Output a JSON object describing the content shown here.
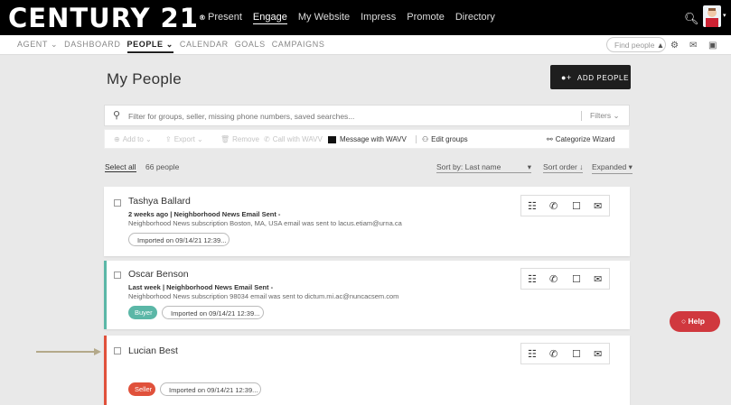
{
  "brand": {
    "logo_text": "CENTURY 21",
    "logo_mark": "®"
  },
  "topnav": [
    "Present",
    "Engage",
    "My Website",
    "Impress",
    "Promote",
    "Directory"
  ],
  "subnav": [
    "AGENT ⌄",
    "DASHBOARD",
    "PEOPLE ⌄",
    "CALENDAR",
    "GOALS",
    "CAMPAIGNS"
  ],
  "find_people_placeholder": "Find people",
  "page": {
    "title": "My People",
    "add_people_label": "ADD PEOPLE",
    "search_placeholder": "Filter for groups, seller, missing phone numbers, saved searches...",
    "filters_label": "Filters ⌄"
  },
  "actions": {
    "add_to": "Add to ⌄",
    "export": "Export ⌄",
    "remove": "Remove",
    "call_wav": "Call with WAVV",
    "message_wav": "Message with WAVV",
    "edit_groups": "Edit groups",
    "categorize_wizard": "Categorize Wizard"
  },
  "list_controls": {
    "select_all": "Select all",
    "count": "66 people",
    "sort_by_label": "Sort by: Last name",
    "sort_caret": "▾",
    "sort_order": "Sort order ↓",
    "view": "Expanded ▾"
  },
  "people": [
    {
      "name": "Tashya Ballard",
      "when": "2 weeks ago",
      "event": "Neighborhood News Email Sent -",
      "detail": "Neighborhood News subscription Boston, MA, USA email was sent to lacus.etiam@urna.ca",
      "imported": "Imported on 09/14/21 12:39..."
    },
    {
      "name": "Oscar Benson",
      "when": "Last week",
      "event": "Neighborhood News Email Sent -",
      "detail": "Neighborhood News subscription 98034 email was sent to dictum.mi.ac@nuncacsem.com",
      "tag": "Buyer",
      "imported": "Imported on 09/14/21 12:39..."
    },
    {
      "name": "Lucian Best",
      "tag": "Seller",
      "imported": "Imported on 09/14/21 12:39..."
    }
  ],
  "help_label": "Help",
  "colors": {
    "buyer": "#5bb7a7",
    "seller": "#e0513b",
    "help": "#d0383e",
    "arrow": "#b4a98a"
  }
}
